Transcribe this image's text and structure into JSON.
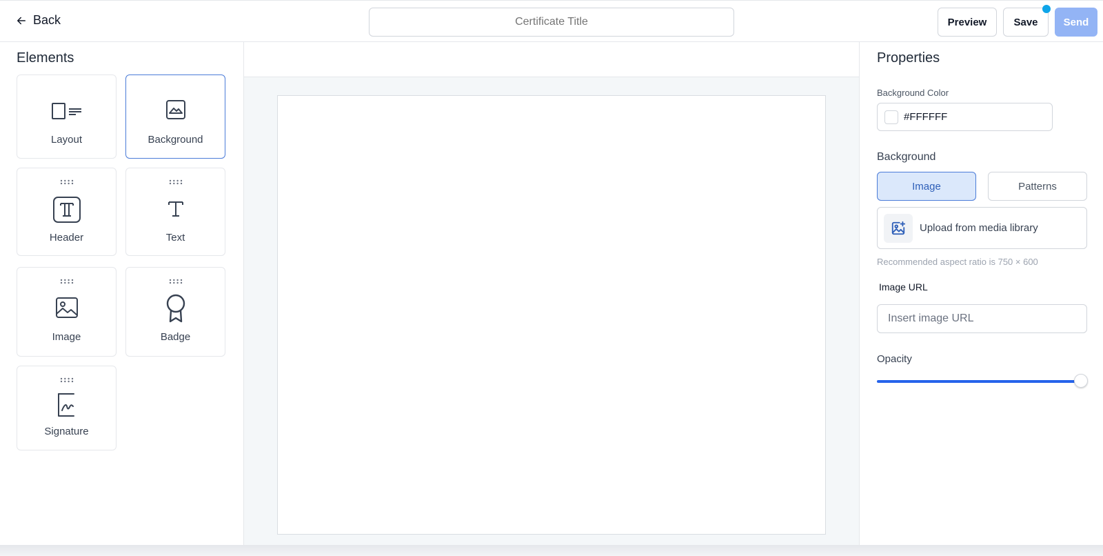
{
  "topbar": {
    "back_label": "Back",
    "title_placeholder": "Certificate Title",
    "preview_label": "Preview",
    "save_label": "Save",
    "send_label": "Send"
  },
  "elements": {
    "heading": "Elements",
    "items": [
      {
        "label": "Layout",
        "icon": "layout-icon"
      },
      {
        "label": "Background",
        "icon": "background-icon"
      },
      {
        "label": "Header",
        "icon": "header-icon"
      },
      {
        "label": "Text",
        "icon": "text-icon"
      },
      {
        "label": "Image",
        "icon": "image-icon"
      },
      {
        "label": "Badge",
        "icon": "badge-icon"
      },
      {
        "label": "Signature",
        "icon": "signature-icon"
      }
    ],
    "selected": "Background"
  },
  "properties": {
    "heading": "Properties",
    "bg_color_label": "Background Color",
    "bg_color_value": "#FFFFFF",
    "background_label": "Background",
    "tabs": [
      "Image",
      "Patterns"
    ],
    "active_tab": "Image",
    "upload_label": "Upload from media library",
    "hint": "Recommended aspect ratio is 750 × 600",
    "image_url_label": "Image URL",
    "image_url_placeholder": "Insert image URL",
    "opacity_label": "Opacity",
    "opacity_value": 1.0
  },
  "colors": {
    "accent": "#2563eb",
    "selected_border": "#4a7bd8",
    "send_disabled": "#93b4f5",
    "save_indicator": "#0ea5e9"
  }
}
